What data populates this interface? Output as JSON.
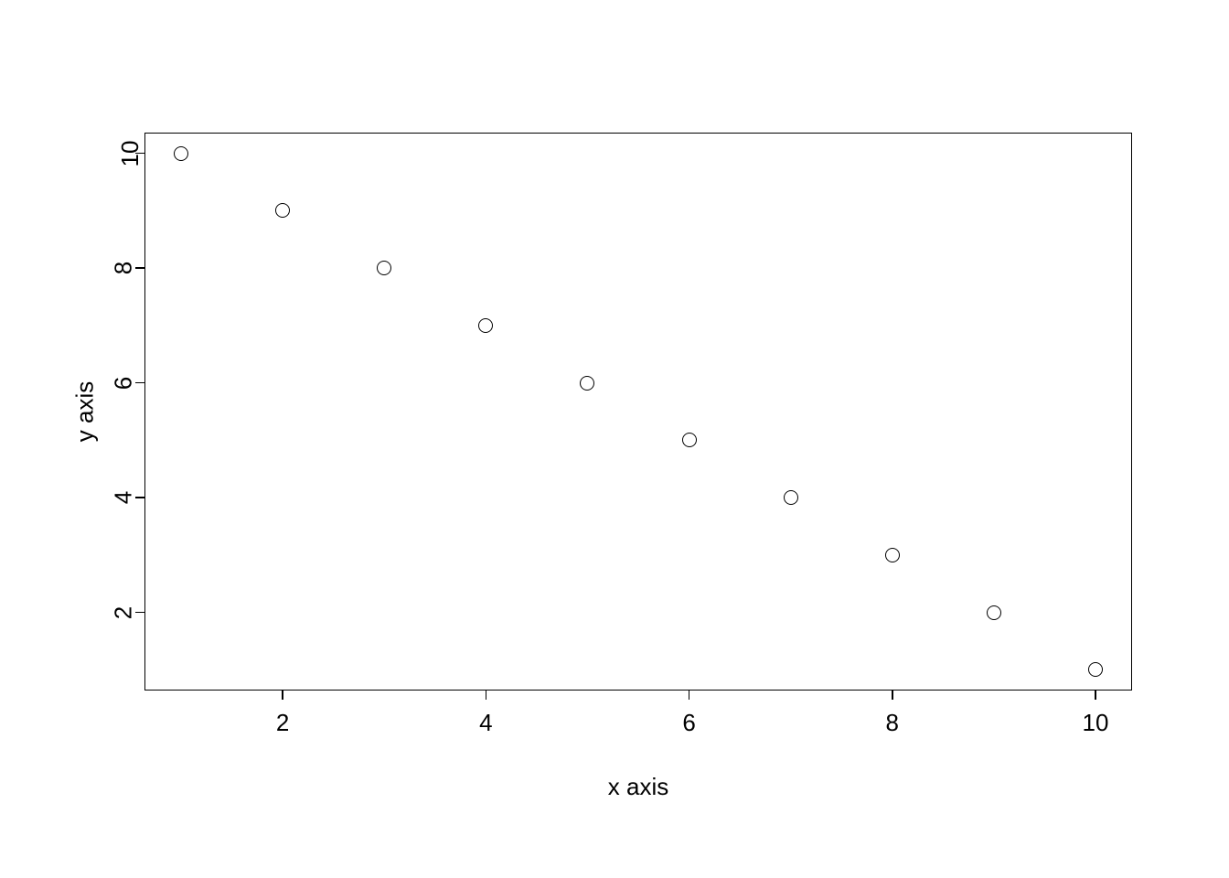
{
  "chart_data": {
    "type": "scatter",
    "x": [
      1,
      2,
      3,
      4,
      5,
      6,
      7,
      8,
      9,
      10
    ],
    "y": [
      10,
      9,
      8,
      7,
      6,
      5,
      4,
      3,
      2,
      1
    ],
    "xlabel": "x axis",
    "ylabel": "y axis",
    "xlim": [
      1,
      10
    ],
    "ylim": [
      1,
      10
    ],
    "xticks": [
      2,
      4,
      6,
      8,
      10
    ],
    "yticks": [
      2,
      4,
      6,
      8,
      10
    ],
    "xtick_labels": [
      "2",
      "4",
      "6",
      "8",
      "10"
    ],
    "ytick_labels": [
      "2",
      "4",
      "6",
      "8",
      "10"
    ]
  }
}
